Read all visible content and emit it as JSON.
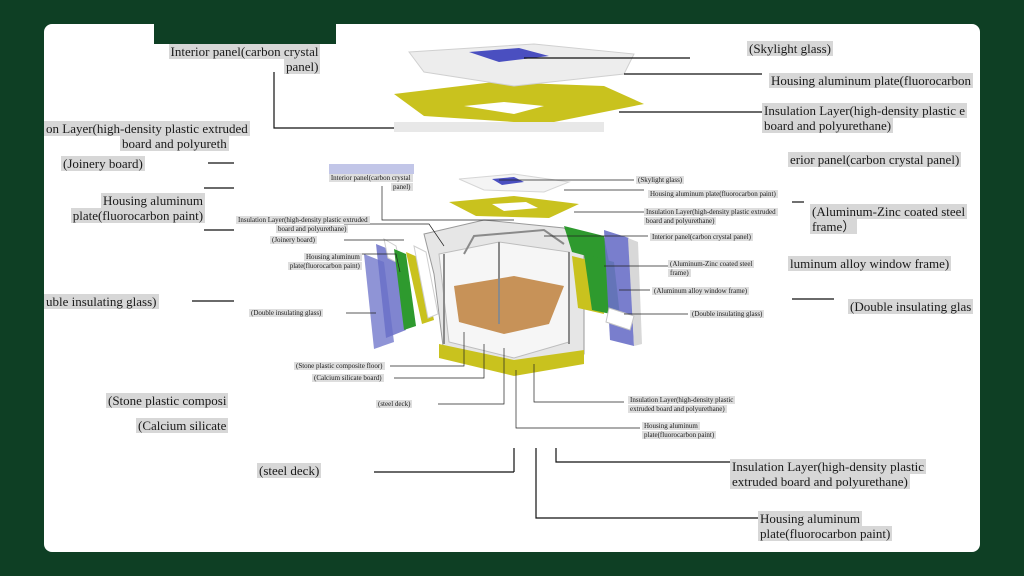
{
  "labels": {
    "top_interior_panel_1": "Interior panel(carbon crystal",
    "top_interior_panel_2": "panel)",
    "top_skylight": "(Skylight glass)",
    "top_housing": "Housing aluminum plate(fluorocarbon",
    "top_insulation_1": "Insulation Layer(high-density plastic e",
    "top_insulation_2": "board and polyurethane)",
    "left_insulation_1": "on Layer(high-density plastic extruded",
    "left_insulation_2": "board and polyureth",
    "left_joinery": "(Joinery board)",
    "left_housing_1": "Housing aluminum",
    "left_housing_2": "plate(fluorocarbon paint)",
    "left_glass": "uble insulating glass)",
    "left_stone": "(Stone plastic composi",
    "left_calcium": "(Calcium silicate",
    "right_interior": "erior panel(carbon crystal panel)",
    "right_alzn_1": "(Aluminum-Zinc coated steel",
    "right_alzn_2": "frame）",
    "right_window": "luminum alloy window frame)",
    "right_glass": "(Double insulating glas",
    "bottom_steel": "(steel deck)",
    "bottom_insulation_1": "Insulation Layer(high-density plastic",
    "bottom_insulation_2": "extruded board and polyurethane)",
    "bottom_housing_1": "Housing aluminum",
    "bottom_housing_2": "plate(fluorocarbon paint)"
  },
  "small_labels": {
    "interior_1": "Interior panel(carbon crystal",
    "interior_2": "panel)",
    "skylight": "(Skylight glass)",
    "housing": "Housing aluminum plate(fluorocarbon paint)",
    "insul_r_1": "Insulation Layer(high-density plastic extruded",
    "insul_r_2": "board and polyurethane)",
    "interior_r": "Interior panel(carbon crystal panel)",
    "insul_l_1": "Insulation Layer(high-density plastic extruded",
    "insul_l_2": "board and polyurethane)",
    "joinery": "(Joinery board)",
    "housing_l_1": "Housing aluminum",
    "housing_l_2": "plate(fluorocarbon paint)",
    "alzn_1": "(Aluminum-Zinc coated steel",
    "alzn_2": "frame)",
    "window": "(Aluminum alloy window frame)",
    "glass_l": "(Double insulating glass)",
    "glass_r": "(Double insulating glass)",
    "stone": "(Stone plastic composite floor)",
    "calcium": "(Calcium silicate board)",
    "steel": "(steel deck)",
    "insul_b_1": "Insulation Layer(high-density plastic",
    "insul_b_2": "extruded board and polyurethane)",
    "housing_b_1": "Housing aluminum",
    "housing_b_2": "plate(fluorocarbon paint)"
  },
  "colors": {
    "background": "#0e3f24",
    "card": "#ffffff",
    "insulation": "#c9c21e",
    "glass": "#6a70c8",
    "green_panel": "#2e9a2e",
    "floor": "#c79258"
  }
}
